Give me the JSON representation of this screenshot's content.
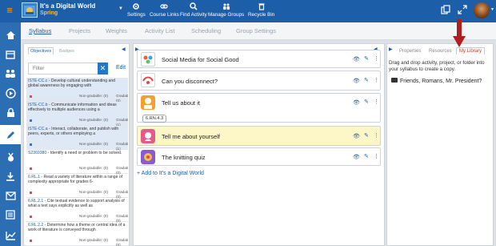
{
  "header": {
    "course_title": "It's a Digital World",
    "course_subtitle": "Spring",
    "nav": [
      {
        "label": "Settings",
        "icon": "gear-icon"
      },
      {
        "label": "Course Links",
        "icon": "link-icon"
      },
      {
        "label": "Find Activity",
        "icon": "search-icon"
      },
      {
        "label": "Manage Groups",
        "icon": "groups-icon"
      },
      {
        "label": "Recycle Bin",
        "icon": "recycle-bin-icon"
      }
    ]
  },
  "subnav": {
    "tabs": [
      "Syllabus",
      "Projects",
      "Weights",
      "Activity List",
      "Scheduling",
      "Group Settings"
    ],
    "active": "Syllabus"
  },
  "left_panel": {
    "tabs": [
      "Objectives",
      "Badges"
    ],
    "active_tab": "Objectives",
    "filter_placeholder": "Filter",
    "clear_label": "✕",
    "edit_label": "Edit",
    "objectives": [
      {
        "code": "ISTE-CC.c",
        "text": " - Develop cultural understanding and global awareness by engaging with",
        "non_gradable": "Non-gradable: (0)",
        "gradable": "Gradable: (0)",
        "color": "#e04a4a",
        "highlight": true
      },
      {
        "code": "ISTE-CC.b",
        "text": " - Communicate information and ideas effectively to multiple audiences using a",
        "non_gradable": "Non-gradable: (0)",
        "gradable": "Gradable: (1)",
        "color": "#2a7ad0",
        "highlight": true
      },
      {
        "code": "ISTE-CC.a",
        "text": " - Interact, collaborate, and publish with peers, experts, or others employing a",
        "non_gradable": "Non-gradable: (0)",
        "gradable": "Gradable: (1)",
        "color": "#2a7ad0",
        "highlight": true
      },
      {
        "code": "S2369380",
        "text": " - Identify a need or problem to be solved.",
        "non_gradable": "Non-gradable: (0)",
        "gradable": "Gradable: (0)",
        "color": "#e04a4a",
        "highlight": false
      },
      {
        "code": "6.RL.1",
        "text": " - Read a variety of literature within a range of complexity appropriate for grades 6-",
        "non_gradable": "Non-gradable: (0)",
        "gradable": "Gradable: (0)",
        "color": "#e04a4a",
        "highlight": false
      },
      {
        "code": "6.RL.2.1",
        "text": " - Cite textual evidence to support analysis of what a text says explicitly as well as",
        "non_gradable": "Non-gradable: (0)",
        "gradable": "Gradable: (0)",
        "color": "#e04a4a",
        "highlight": false
      },
      {
        "code": "6.RL.2.2",
        "text": " - Determine how a theme or central idea of a work of literature is conveyed through",
        "non_gradable": "Non-gradable: (0)",
        "gradable": "Gradable: (0)",
        "color": "#e04a4a",
        "highlight": false
      }
    ]
  },
  "center": {
    "activities": [
      {
        "title": "Social Media for Social Good",
        "tag": "",
        "highlight": false
      },
      {
        "title": "Can you disconnect?",
        "tag": "",
        "highlight": false
      },
      {
        "title": "Tell us about it",
        "tag": "6.RN.4.3",
        "highlight": false
      },
      {
        "title": "Tell me about yourself",
        "tag": "",
        "highlight": true
      },
      {
        "title": "The knitting quiz",
        "tag": "",
        "highlight": false
      }
    ],
    "add_link": "Add to It's a Digital World"
  },
  "right_panel": {
    "tabs": [
      "Properties",
      "Resources",
      "My Library"
    ],
    "active_tab": "My Library",
    "description": "Drag and drop activity, project, or folder into your syllabus to create a copy.",
    "folder": "Friends, Romans, Mr. President?"
  },
  "colors": {
    "header": "#1c5ea8",
    "sidebar": "#2c6eb4",
    "accent_red": "#c43e2a",
    "highlight_yellow": "#fdf6c7"
  }
}
